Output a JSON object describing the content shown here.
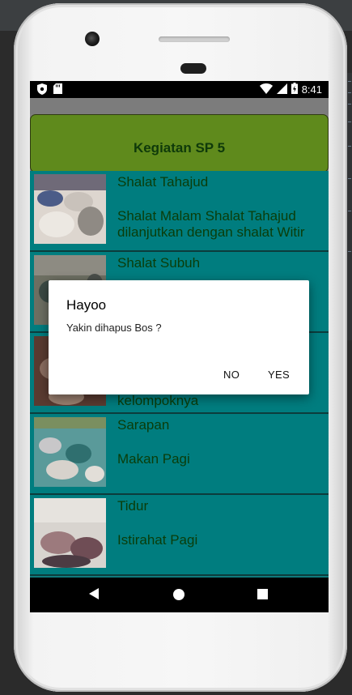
{
  "status_bar": {
    "time": "8:41"
  },
  "header": {
    "title": "Kegiatan SP 5"
  },
  "items": [
    {
      "title": "Shalat Tahajud",
      "desc": "Shalat Malam Shalat Tahajud dilanjutkan dengan shalat Witir",
      "thumb_colors": [
        "#ddd6cf",
        "#6f6a78",
        "#4b5c88",
        "#c9c2bb"
      ]
    },
    {
      "title": "Shalat Subuh",
      "desc": "",
      "thumb_colors": [
        "#6d6f62",
        "#3b4a44",
        "#8d8b82",
        "#2c2f33"
      ]
    },
    {
      "title": "",
      "desc": "kelompoknya",
      "thumb_colors": [
        "#5a3b31",
        "#8b6d5f",
        "#3b2a23",
        "#9b8070"
      ]
    },
    {
      "title": "Sarapan",
      "desc": "Makan Pagi",
      "thumb_colors": [
        "#5a9a9a",
        "#c8c7c9",
        "#2f6f6f",
        "#d7d2cc"
      ]
    },
    {
      "title": "Tidur",
      "desc": "Istirahat Pagi",
      "thumb_colors": [
        "#9c7a7d",
        "#d8d4cf",
        "#6f4d55",
        "#4c3b43"
      ]
    }
  ],
  "dialog": {
    "title": "Hayoo",
    "message": "Yakin dihapus Bos ?",
    "no_label": "NO",
    "yes_label": "YES"
  },
  "colors": {
    "header_bg": "#5f8a1c",
    "list_bg": "#007d7f",
    "text": "#0a3d0a"
  }
}
